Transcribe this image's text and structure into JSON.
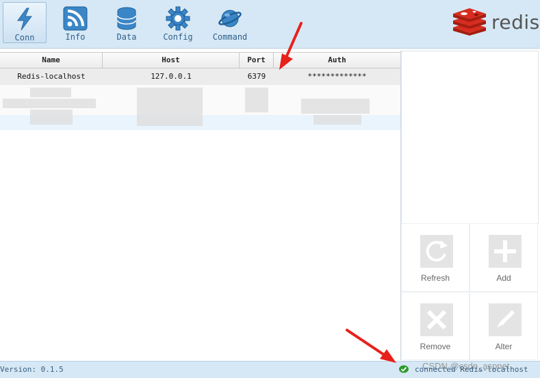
{
  "toolbar": {
    "buttons": [
      {
        "label": "Conn",
        "icon": "lightning-icon"
      },
      {
        "label": "Info",
        "icon": "rss-icon"
      },
      {
        "label": "Data",
        "icon": "database-icon"
      },
      {
        "label": "Config",
        "icon": "gear-icon"
      },
      {
        "label": "Command",
        "icon": "planet-icon"
      }
    ],
    "logo_text": "redis"
  },
  "table": {
    "columns": [
      "Name",
      "Host",
      "Port",
      "Auth"
    ],
    "rows": [
      {
        "name": "Redis-localhost",
        "host": "127.0.0.1",
        "port": "6379",
        "auth": "*************"
      }
    ]
  },
  "actions": {
    "refresh": "Refresh",
    "add": "Add",
    "remove": "Remove",
    "alter": "Alter"
  },
  "status": {
    "version": "Version: 0.1.5",
    "connection": "connected Redis-localhost",
    "watermark": "CSDN @csdn_aspnet"
  },
  "colors": {
    "accent": "#3b86c6",
    "toolbar_bg": "#d6e8f5",
    "logo_red": "#d82c20",
    "arrow_red": "#e8201a"
  }
}
